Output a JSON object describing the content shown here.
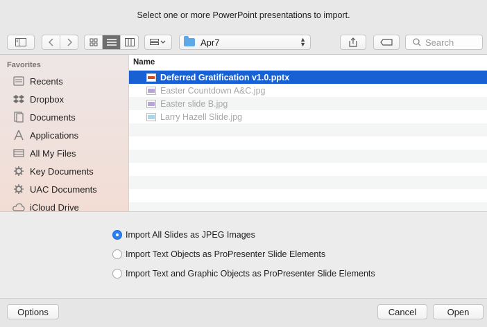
{
  "dialog": {
    "title": "Select one or more PowerPoint presentations to import."
  },
  "toolbar": {
    "path_label": "Apr7",
    "search_placeholder": "Search"
  },
  "sidebar": {
    "heading": "Favorites",
    "items": [
      {
        "label": "Recents",
        "icon": "clock-icon"
      },
      {
        "label": "Dropbox",
        "icon": "dropbox-icon"
      },
      {
        "label": "Documents",
        "icon": "documents-icon"
      },
      {
        "label": "Applications",
        "icon": "applications-icon"
      },
      {
        "label": "All My Files",
        "icon": "all-files-icon"
      },
      {
        "label": "Key Documents",
        "icon": "gear-folder-icon"
      },
      {
        "label": "UAC Documents",
        "icon": "gear-folder-icon"
      },
      {
        "label": "iCloud Drive",
        "icon": "cloud-icon"
      }
    ]
  },
  "filelist": {
    "column_name": "Name",
    "files": [
      {
        "name": "Deferred Gratification v1.0.pptx",
        "selected": true
      },
      {
        "name": "Easter Countdown A&C.jpg",
        "selected": false
      },
      {
        "name": "Easter slide B.jpg",
        "selected": false
      },
      {
        "name": "Larry Hazell Slide.jpg",
        "selected": false
      }
    ]
  },
  "import_options": [
    {
      "label": "Import All Slides as JPEG Images",
      "checked": true
    },
    {
      "label": "Import Text Objects as ProPresenter Slide Elements",
      "checked": false
    },
    {
      "label": "Import Text and Graphic Objects as ProPresenter Slide Elements",
      "checked": false
    }
  ],
  "buttons": {
    "options": "Options",
    "cancel": "Cancel",
    "open": "Open"
  },
  "colors": {
    "selection": "#1761d5",
    "radio_on": "#2b7ff2"
  }
}
